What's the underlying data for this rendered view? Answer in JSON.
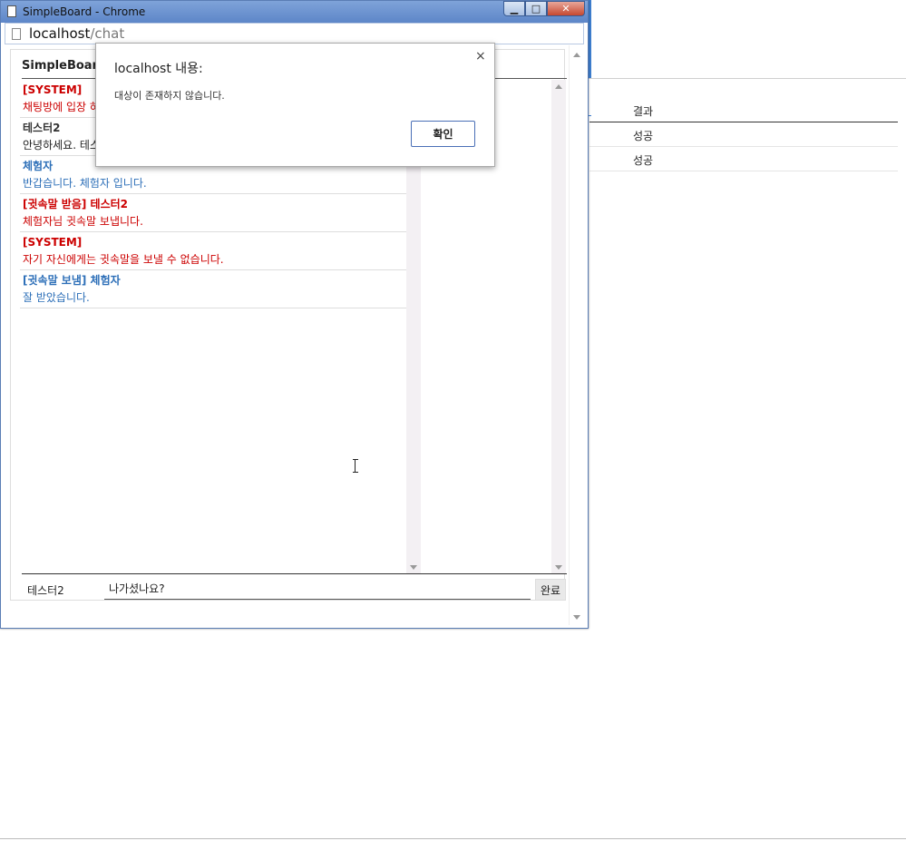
{
  "background": {
    "table_header": "결과",
    "rows": [
      "성공",
      "성공"
    ]
  },
  "window": {
    "title": "SimpleBoard - Chrome",
    "min_glyph": "▁",
    "max_glyph": "□",
    "close_glyph": "✕",
    "url_host": "localhost",
    "url_path": "/chat"
  },
  "chat": {
    "board_title": "SimpleBoard",
    "messages": [
      {
        "who": "[SYSTEM]",
        "text": "채팅방에 입장 하",
        "kind": "system"
      },
      {
        "who": "테스터2",
        "text": "안녕하세요. 테스",
        "kind": "other"
      },
      {
        "who": "체험자",
        "text": "반갑습니다. 체험자 입니다.",
        "kind": "me"
      },
      {
        "who": "[귓속말 받음] 테스터2",
        "text": "체험자님 귓속말 보냅니다.",
        "kind": "system"
      },
      {
        "who": "[SYSTEM]",
        "text": "자기 자신에게는 귓속말을 보낼 수 없습니다.",
        "kind": "system"
      },
      {
        "who": "[귓속말 보냄] 체험자",
        "text": "잘 받았습니다.",
        "kind": "me"
      }
    ],
    "input_name": "테스터2",
    "input_value": "나가셨나요?",
    "send_label": "완료"
  },
  "dialog": {
    "title": "localhost 내용:",
    "close_glyph": "×",
    "message": "대상이 존재하지 않습니다.",
    "ok_label": "확인"
  },
  "colors": {
    "system": "#cc0000",
    "me": "#2d6fb8",
    "other": "#333333"
  }
}
